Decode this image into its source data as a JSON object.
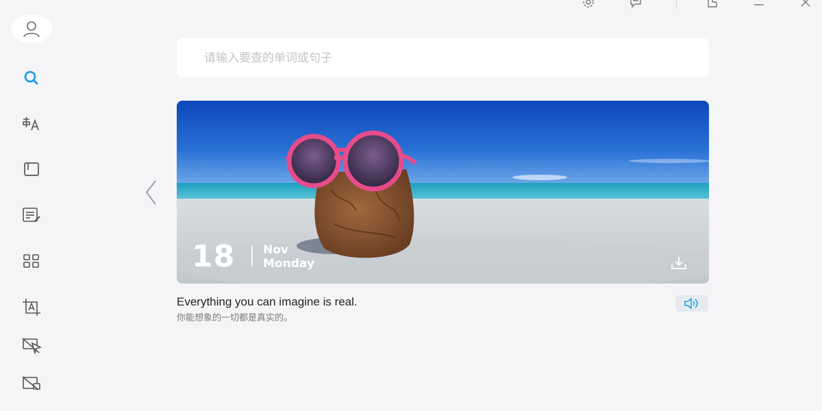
{
  "sidebar": {
    "items": [
      {
        "name": "avatar",
        "icon": "user-icon"
      },
      {
        "name": "search",
        "icon": "search-icon",
        "active": true
      },
      {
        "name": "translate",
        "icon": "translate-icon"
      },
      {
        "name": "wordbook",
        "icon": "book-icon"
      },
      {
        "name": "writing",
        "icon": "edit-document-icon"
      },
      {
        "name": "apps",
        "icon": "grid-icon"
      },
      {
        "name": "ocr",
        "icon": "text-recognition-icon"
      },
      {
        "name": "screen-translate",
        "icon": "pointer-disabled-icon"
      },
      {
        "name": "image-translate",
        "icon": "image-disabled-icon"
      }
    ]
  },
  "titlebar": {
    "buttons": [
      "settings-icon",
      "feedback-icon",
      "pin-icon",
      "minimize-icon",
      "close-icon"
    ]
  },
  "search": {
    "placeholder": "请输入要查的单词或句子",
    "value": ""
  },
  "banner": {
    "day": "18",
    "month": "Nov",
    "weekday": "Monday"
  },
  "quote": {
    "english": "Everything you can imagine is real.",
    "chinese": "你能想象的一切都是真实的。"
  },
  "colors": {
    "accent": "#1aa0e8",
    "background": "#f5f5f7",
    "icon": "#555555"
  }
}
